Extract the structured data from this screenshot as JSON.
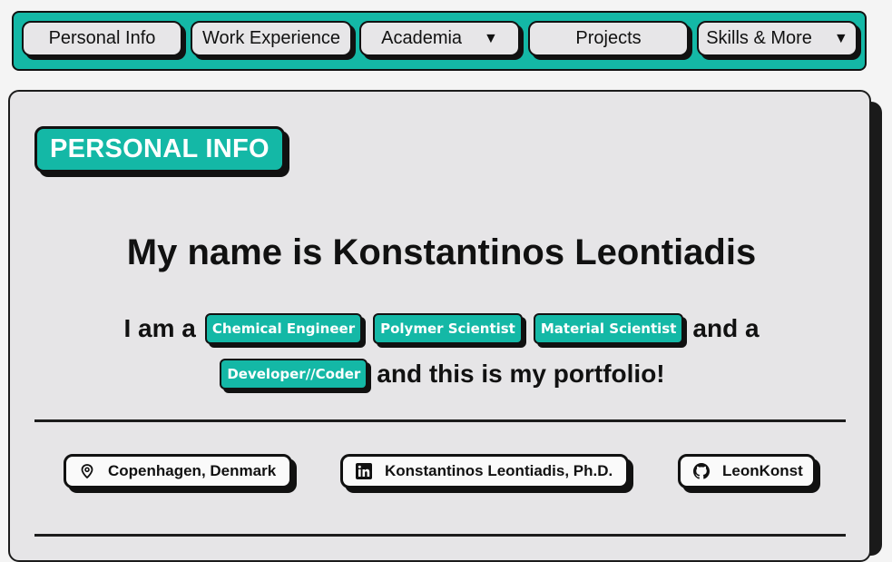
{
  "nav": {
    "items": [
      {
        "label": "Personal Info",
        "dropdown": false
      },
      {
        "label": "Work Experience",
        "dropdown": false
      },
      {
        "label": "Academia",
        "dropdown": true
      },
      {
        "label": "Projects",
        "dropdown": false
      },
      {
        "label": "Skills & More",
        "dropdown": true
      }
    ],
    "dropdown_glyph": "▼"
  },
  "section": {
    "tag": "PERSONAL INFO",
    "headline": "My name is Konstantinos Leontiadis",
    "intro_prefix": "I am a",
    "roles": [
      "Chemical Engineer",
      "Polymer Scientist",
      "Material Scientist",
      "Developer//Coder"
    ],
    "intro_mid": "and a",
    "intro_suffix": "and this is my portfolio!"
  },
  "contacts": [
    {
      "icon": "location-pin-icon",
      "label": "Copenhagen, Denmark"
    },
    {
      "icon": "linkedin-icon",
      "label": "Konstantinos Leontiadis, Ph.D."
    },
    {
      "icon": "github-icon",
      "label": "LeonKonst"
    }
  ],
  "colors": {
    "accent": "#14b8a6",
    "card_bg": "#e6e5e7",
    "page_bg": "#f4f4f4",
    "ink": "#111111"
  }
}
